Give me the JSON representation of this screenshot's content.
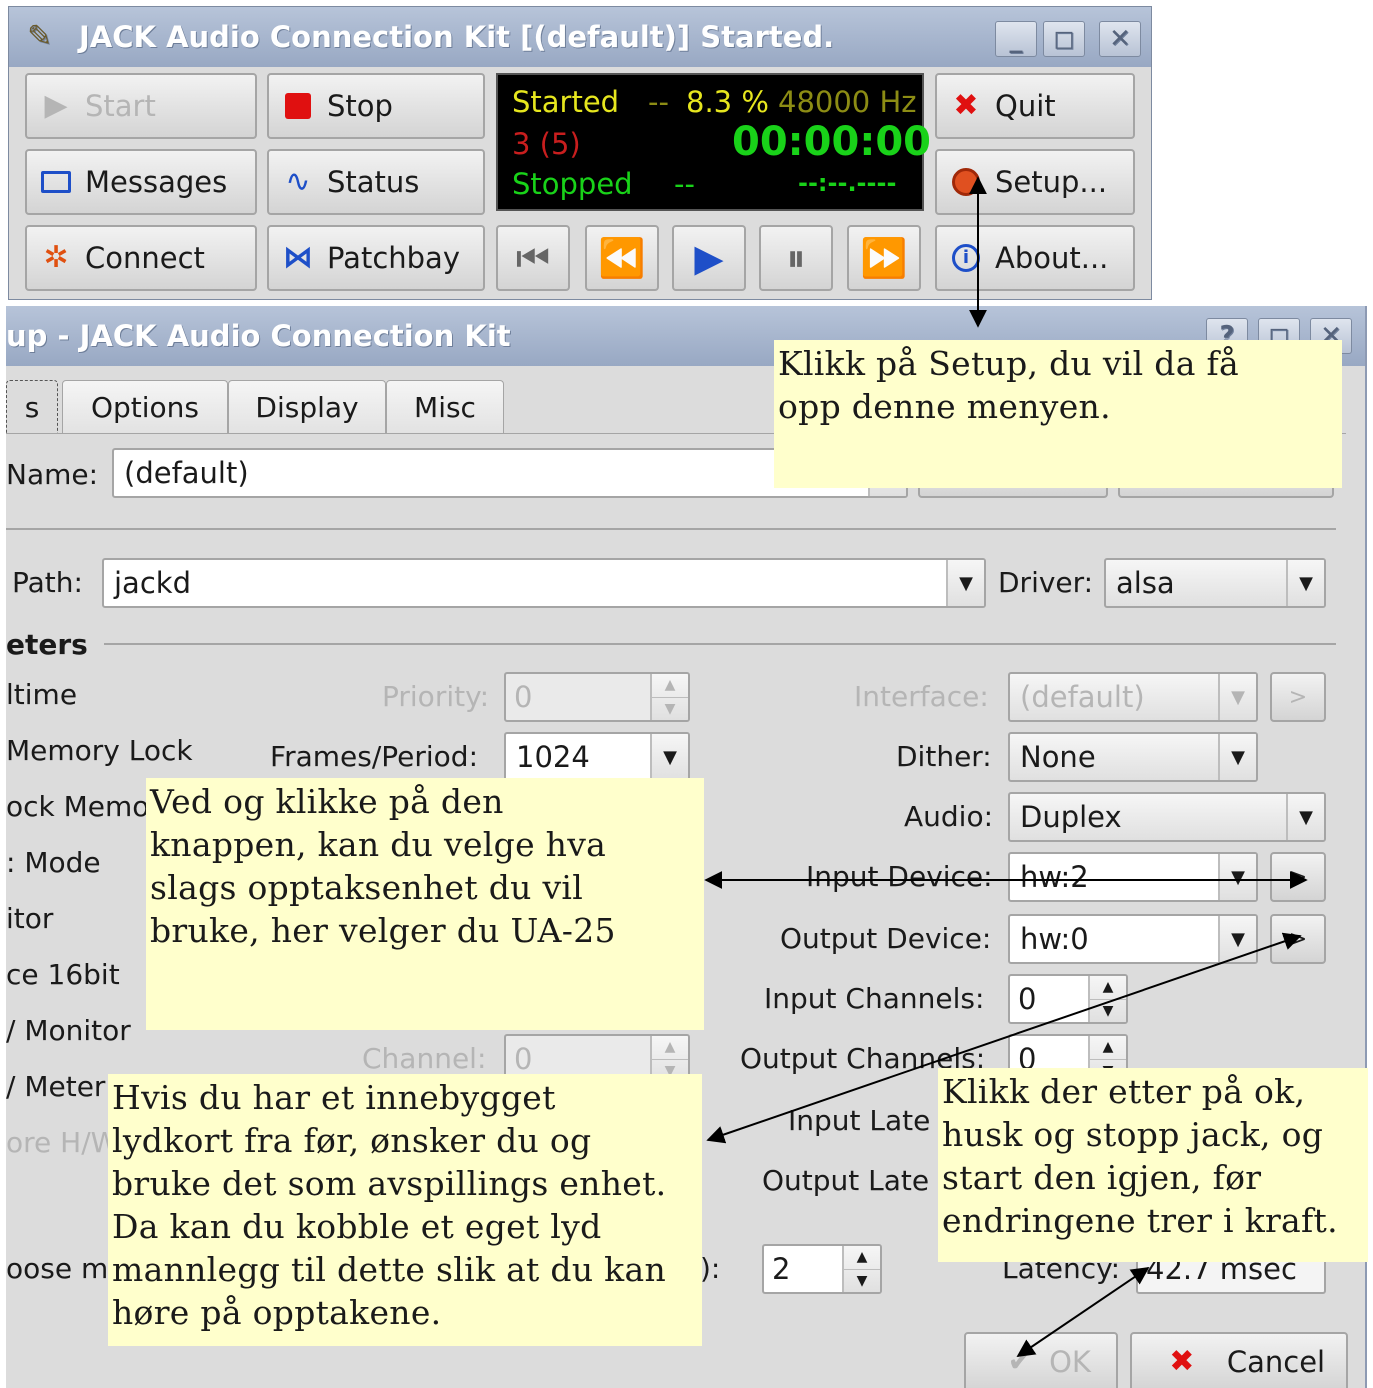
{
  "main": {
    "title": "JACK Audio Connection Kit [(default)] Started.",
    "buttons": {
      "start": "Start",
      "stop": "Stop",
      "quit": "Quit",
      "messages": "Messages",
      "status": "Status",
      "setup": "Setup...",
      "connect": "Connect",
      "patchbay": "Patchbay",
      "about": "About..."
    },
    "display": {
      "state": "Started",
      "dsp_sep": "--",
      "dsp_load": "8.3 %",
      "sample_rate": "48000 Hz",
      "xruns": "3 (5)",
      "time": "00:00:00",
      "transport": "Stopped",
      "transport_sep": "--",
      "bbt": "--:--.----"
    },
    "colors": {
      "green": "#19d219",
      "yellow": "#e6e61e",
      "red": "#c81e1e",
      "dim_yellow": "#8c8c14"
    }
  },
  "setup": {
    "title": "up - JACK Audio Connection Kit",
    "tabs": [
      "s",
      "Options",
      "Display",
      "Misc"
    ],
    "name_label": "Name:",
    "name_value": "(default)",
    "path_label": "Path:",
    "path_value": "jackd",
    "driver_label": "Driver:",
    "driver_value": "alsa",
    "section_parameters": "eters",
    "left_options": [
      "ltime",
      "Memory Lock",
      "ock Memo",
      ": Mode",
      "itor",
      "ce 16bit",
      "/ Monitor",
      "/ Meter",
      "ore H/W",
      "oose m"
    ],
    "priority_label": "Priority:",
    "priority_value": "0",
    "frames_label": "Frames/Period:",
    "frames_value": "1024",
    "channel_label": "Channel:",
    "channel_value": "0",
    "interface_label": "Interface:",
    "interface_value": "(default)",
    "dither_label": "Dither:",
    "dither_value": "None",
    "audio_label": "Audio:",
    "audio_value": "Duplex",
    "input_device_label": "Input Device:",
    "input_device_value": "hw:2",
    "output_device_label": "Output Device:",
    "output_device_value": "hw:0",
    "input_channels_label": "Input Channels:",
    "input_channels_value": "0",
    "output_channels_label": "Output Channels:",
    "output_channels_value": "0",
    "input_latency_label": "Input Late",
    "output_latency_label": "Output Late",
    "wait_label": "cs):",
    "wait_value": "2",
    "latency_label": "Latency:",
    "latency_value": "42.7 msec",
    "ok_label": "OK",
    "cancel_label": "Cancel",
    "help_btn": "?",
    "browse_btn": ">"
  },
  "annotations": {
    "setup_note": "Klikk på Setup, du vil da få\nopp denne menyen.",
    "device_note": "Ved og klikke på den\nknappen, kan du velge hva\nslags opptaksenhet du vil\nbruke, her velger du UA-25",
    "output_note": "Hvis du har et innebygget\nlydkort fra før, ønsker du og\nbruke det som avspillings enhet.\nDa kan du kobble et eget lyd\nmannlegg til dette slik at du kan\nhøre på opptakene.",
    "ok_note": "Klikk der etter på ok,\nhusk og stopp jack, og\nstart den igjen, før\nendringene trer i kraft."
  }
}
